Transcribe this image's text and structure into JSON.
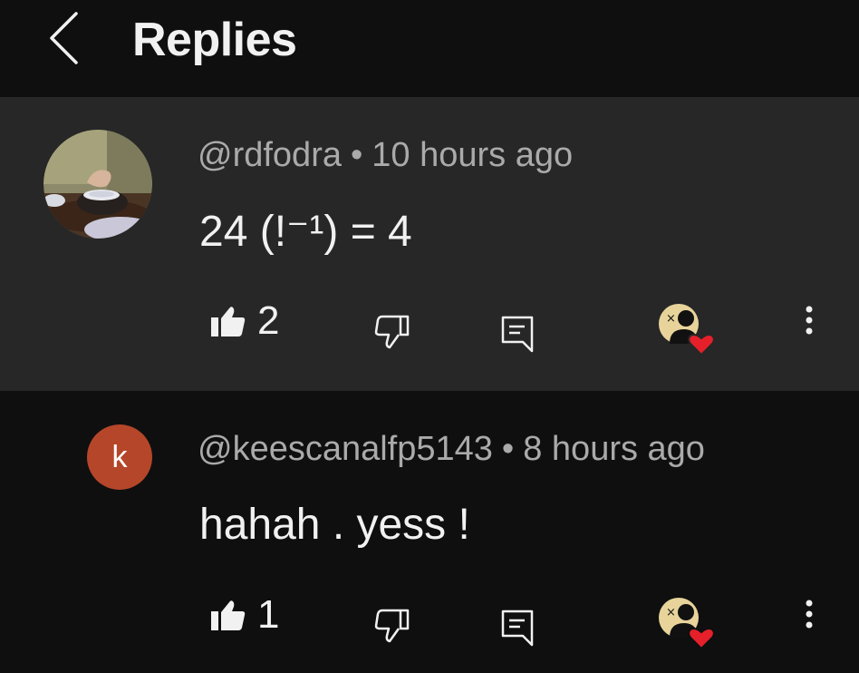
{
  "header": {
    "title": "Replies",
    "back_icon": "chevron-left-icon"
  },
  "comments": [
    {
      "author": "@rdfodra",
      "separator": "•",
      "time": "10 hours ago",
      "text": "24 (!⁻¹) = 4",
      "likes": "2",
      "avatar": "photo"
    },
    {
      "author": "@keescanalfp5143",
      "separator": "•",
      "time": "8 hours ago",
      "text": "hahah . yess !",
      "likes": "1",
      "avatar_letter": "k",
      "avatar_color": "#b5462a"
    }
  ],
  "icons": {
    "like": "thumbs-up-icon",
    "dislike": "thumbs-down-icon",
    "reply": "comment-icon",
    "creator_heart": "creator-heart-icon",
    "more": "more-vertical-icon"
  },
  "colors": {
    "background": "#0f0f0f",
    "highlight": "#272727",
    "heart": "#e5202a"
  }
}
